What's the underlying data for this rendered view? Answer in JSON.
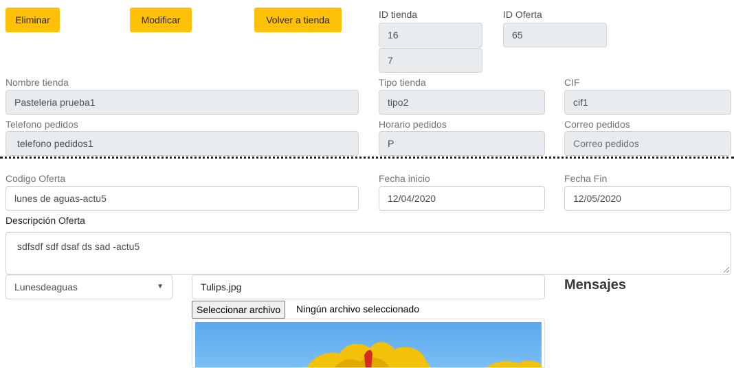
{
  "actions": {
    "delete_label": "Eliminar",
    "modify_label": "Modificar",
    "back_label": "Volver a tienda"
  },
  "ids": {
    "store_id_label": "ID tienda",
    "store_id_value": "16",
    "store_id_extra": "7",
    "offer_id_label": "ID Oferta",
    "offer_id_value": "65"
  },
  "store": {
    "name_label": "Nombre tienda",
    "name_value": "Pasteleria prueba1",
    "type_label": "Tipo tienda",
    "type_value": "tipo2",
    "cif_label": "CIF",
    "cif_value": "cif1",
    "phone_label": "Telefono pedidos",
    "phone_value": "telefono pedidos1",
    "schedule_label": "Horario pedidos",
    "schedule_value": "P",
    "email_label": "Correo pedidos",
    "email_placeholder": "Correo pedidos"
  },
  "offer": {
    "code_label": "Codigo Oferta",
    "code_value": "lunes de aguas-actu5",
    "start_label": "Fecha inicio",
    "start_value": "12/04/2020",
    "end_label": "Fecha Fin",
    "end_value": "12/05/2020",
    "description_label": "Descripción Oferta",
    "description_value": "sdfsdf sdf dsaf ds sad -actu5",
    "category_selected": "Lunesdeaguas",
    "image_filename": "Tulips.jpg",
    "file_button_label": "Seleccionar archivo",
    "file_status": "Ningún archivo seleccionado"
  },
  "messages": {
    "heading": "Mensajes"
  },
  "colors": {
    "button_bg": "#ffc107",
    "readonly_bg": "#e9ecef",
    "border": "#ced4da"
  }
}
